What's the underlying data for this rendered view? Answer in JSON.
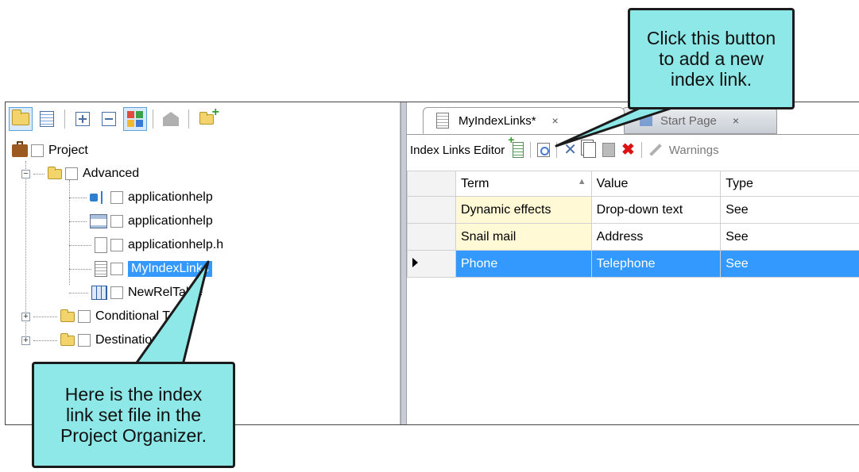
{
  "left_panel": {
    "toolbar_icons": [
      "folder-icon",
      "list-view-icon",
      "expand-all-icon",
      "collapse-all-icon",
      "color-grid-icon",
      "disabled-action-icon",
      "new-folder-icon"
    ],
    "tree": {
      "root": "Project",
      "advanced": "Advanced",
      "items": [
        {
          "label": "applicationhelp",
          "icon": "flow-icon"
        },
        {
          "label": "applicationhelp",
          "icon": "frameset-icon"
        },
        {
          "label": "applicationhelp.h",
          "icon": "header-file-icon"
        },
        {
          "label": "MyIndexLinks",
          "icon": "index-link-set-icon"
        },
        {
          "label": "NewRelTable",
          "icon": "relationship-table-icon"
        }
      ],
      "folders": [
        "Conditional Text",
        "Destinations"
      ]
    }
  },
  "tabs": {
    "active": "MyIndexLinks*",
    "inactive": "Start Page",
    "close": "×"
  },
  "editor": {
    "title": "Index Links Editor",
    "warnings": "Warnings",
    "columns": {
      "term": "Term",
      "value": "Value",
      "type": "Type"
    },
    "rows": [
      {
        "term": "Dynamic effects",
        "value": "Drop-down text",
        "type": "See"
      },
      {
        "term": "Snail mail",
        "value": "Address",
        "type": "See"
      },
      {
        "term": "Phone",
        "value": "Telephone",
        "type": "See"
      }
    ]
  },
  "callouts": {
    "top": [
      "Click this button",
      "to add a new",
      "index link."
    ],
    "bottom": [
      "Here is the index",
      "link set file in the",
      "Project Organizer."
    ]
  },
  "colors": {
    "callout_fill": "#8ee8e8",
    "selection": "#3399ff",
    "term_cell": "#fff9d6"
  }
}
